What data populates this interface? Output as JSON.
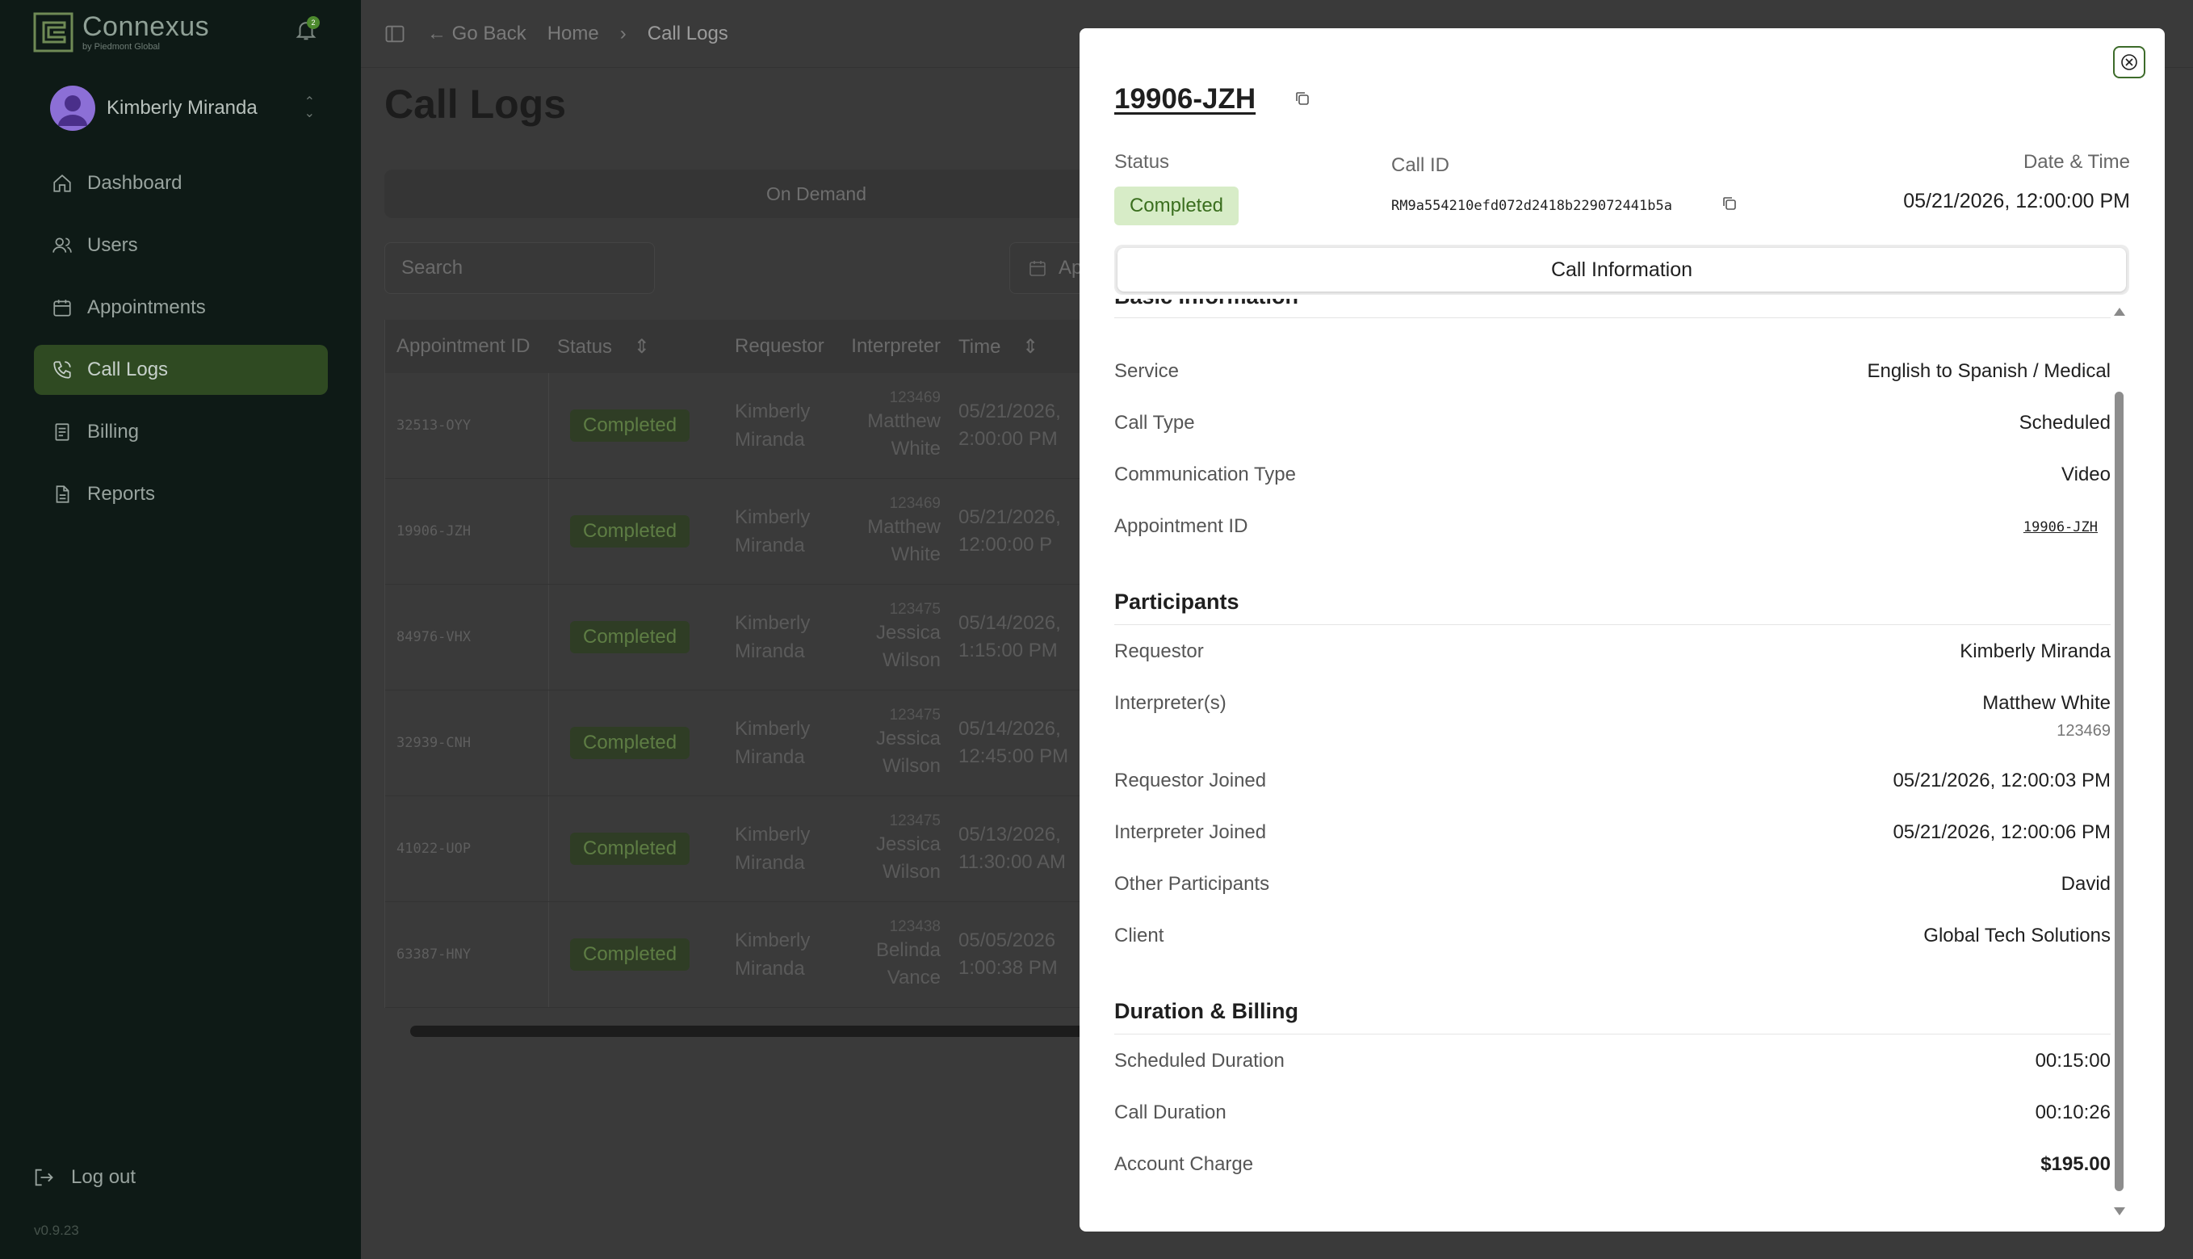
{
  "sidebar": {
    "brand_name": "Connexus",
    "brand_sub": "by Piedmont Global",
    "bell_count": "2",
    "user_name": "Kimberly Miranda",
    "nav": [
      {
        "label": "Dashboard",
        "icon": "home-icon"
      },
      {
        "label": "Users",
        "icon": "users-icon"
      },
      {
        "label": "Appointments",
        "icon": "calendar-icon"
      },
      {
        "label": "Call Logs",
        "icon": "phone-icon",
        "active": true
      },
      {
        "label": "Billing",
        "icon": "receipt-icon"
      },
      {
        "label": "Reports",
        "icon": "document-icon"
      }
    ],
    "logout": "Log out",
    "version": "v0.9.23"
  },
  "topbar": {
    "back": "Go Back",
    "crumb_home": "Home",
    "crumb_current": "Call Logs"
  },
  "page": {
    "title": "Call Logs",
    "segment": "On Demand",
    "search_placeholder": "Search",
    "date_button": "Ap"
  },
  "table": {
    "headers": [
      "Appointment ID",
      "Status",
      "Requestor",
      "Interpreter",
      "Time"
    ],
    "rows": [
      {
        "id": "32513-OYY",
        "status": "Completed",
        "req1": "Kimberly",
        "req2": "Miranda",
        "int_id": "123469",
        "int1": "Matthew",
        "int2": "White",
        "t1": "05/21/2026,",
        "t2": "2:00:00 PM"
      },
      {
        "id": "19906-JZH",
        "status": "Completed",
        "req1": "Kimberly",
        "req2": "Miranda",
        "int_id": "123469",
        "int1": "Matthew",
        "int2": "White",
        "t1": "05/21/2026,",
        "t2": "12:00:00 P"
      },
      {
        "id": "84976-VHX",
        "status": "Completed",
        "req1": "Kimberly",
        "req2": "Miranda",
        "int_id": "123475",
        "int1": "Jessica",
        "int2": "Wilson",
        "t1": "05/14/2026,",
        "t2": "1:15:00 PM"
      },
      {
        "id": "32939-CNH",
        "status": "Completed",
        "req1": "Kimberly",
        "req2": "Miranda",
        "int_id": "123475",
        "int1": "Jessica",
        "int2": "Wilson",
        "t1": "05/14/2026,",
        "t2": "12:45:00 PM"
      },
      {
        "id": "41022-UOP",
        "status": "Completed",
        "req1": "Kimberly",
        "req2": "Miranda",
        "int_id": "123475",
        "int1": "Jessica",
        "int2": "Wilson",
        "t1": "05/13/2026,",
        "t2": "11:30:00 AM"
      },
      {
        "id": "63387-HNY",
        "status": "Completed",
        "req1": "Kimberly",
        "req2": "Miranda",
        "int_id": "123438",
        "int1": "Belinda",
        "int2": "Vance",
        "t1": "05/05/2026",
        "t2": "1:00:38 PM"
      }
    ]
  },
  "modal": {
    "title": "19906-JZH",
    "status_label": "Status",
    "status": "Completed",
    "call_id_label": "Call ID",
    "call_id": "RM9a554210efd072d2418b229072441b5a",
    "date_label": "Date & Time",
    "datetime": "05/21/2026, 12:00:00 PM",
    "tab": "Call Information",
    "basic_heading": "Basic Information",
    "basic": [
      {
        "label": "Service",
        "value": "English to Spanish / Medical"
      },
      {
        "label": "Call Type",
        "value": "Scheduled"
      },
      {
        "label": "Communication Type",
        "value": "Video"
      },
      {
        "label": "Appointment ID",
        "value": "19906-JZH"
      }
    ],
    "participants_heading": "Participants",
    "participants": [
      {
        "label": "Requestor",
        "value": "Kimberly Miranda"
      },
      {
        "label": "Interpreter(s)",
        "value": "Matthew White",
        "sub": "123469"
      },
      {
        "label": "Requestor Joined",
        "value": "05/21/2026, 12:00:03 PM"
      },
      {
        "label": "Interpreter Joined",
        "value": "05/21/2026, 12:00:06 PM"
      },
      {
        "label": "Other Participants",
        "value": "David"
      },
      {
        "label": "Client",
        "value": "Global Tech Solutions"
      }
    ],
    "billing_heading": "Duration & Billing",
    "billing": [
      {
        "label": "Scheduled Duration",
        "value": "00:15:00"
      },
      {
        "label": "Call Duration",
        "value": "00:10:26"
      },
      {
        "label": "Account Charge",
        "value": "$195.00"
      }
    ]
  }
}
